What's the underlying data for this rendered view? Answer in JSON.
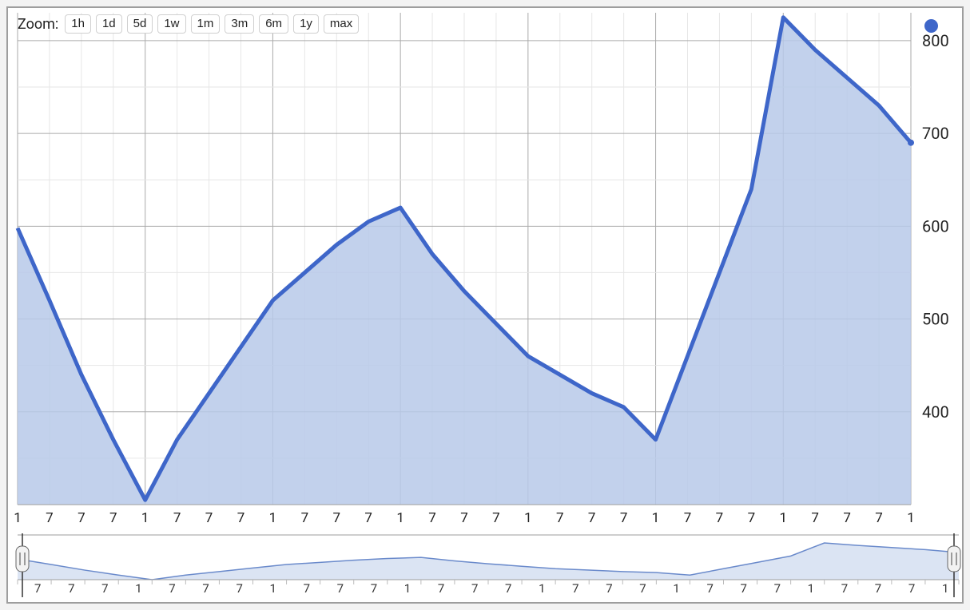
{
  "zoom": {
    "label": "Zoom:",
    "options": [
      "1h",
      "1d",
      "5d",
      "1w",
      "1m",
      "3m",
      "6m",
      "1y",
      "max"
    ]
  },
  "legend": {
    "color": "#3e66c9"
  },
  "y_axis": {
    "min": 300,
    "max": 830,
    "ticks": [
      400,
      500,
      600,
      700,
      800
    ]
  },
  "x_axis": {
    "ticks": [
      "1",
      "7",
      "7",
      "7",
      "1",
      "7",
      "7",
      "7",
      "1",
      "7",
      "7",
      "7",
      "1",
      "7",
      "7",
      "7",
      "1",
      "7",
      "7",
      "7",
      "1",
      "7",
      "7",
      "7",
      "1",
      "7",
      "7",
      "7",
      "1"
    ]
  },
  "overview_ticks": [
    "7",
    "7",
    "7",
    "1",
    "7",
    "7",
    "7",
    "1",
    "7",
    "7",
    "7",
    "1",
    "7",
    "7",
    "7",
    "1",
    "7",
    "7",
    "7",
    "1",
    "7",
    "7",
    "7",
    "1",
    "7",
    "7",
    "7",
    "1"
  ],
  "chart_data": {
    "type": "area",
    "title": "",
    "xlabel": "",
    "ylabel": "",
    "ylim": [
      300,
      830
    ],
    "x": [
      0,
      1,
      2,
      3,
      4,
      5,
      6,
      7,
      8,
      9,
      10,
      11,
      12,
      13,
      14,
      15,
      16,
      17,
      18,
      19,
      20,
      21,
      22,
      23,
      24,
      25,
      26,
      27,
      28
    ],
    "values": [
      598,
      520,
      440,
      370,
      305,
      370,
      420,
      470,
      520,
      550,
      580,
      605,
      620,
      570,
      530,
      495,
      460,
      440,
      420,
      405,
      370,
      460,
      550,
      640,
      825,
      790,
      760,
      730,
      690
    ]
  }
}
